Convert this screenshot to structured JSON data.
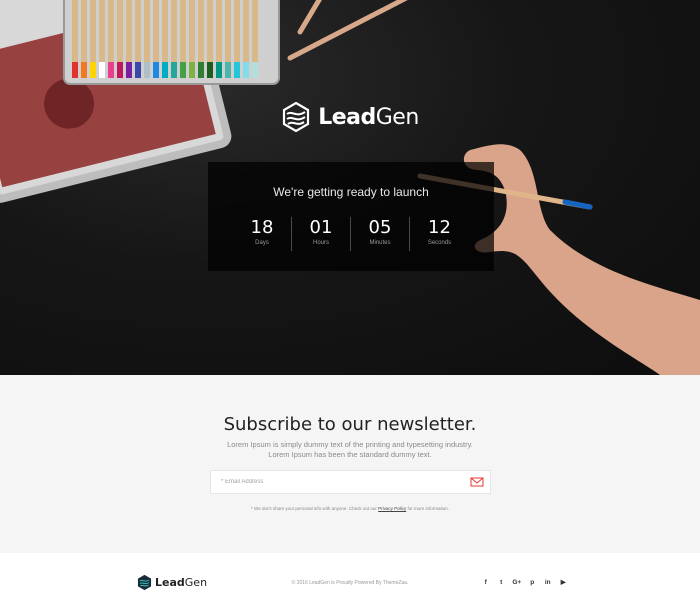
{
  "brand": {
    "name_bold": "Lead",
    "name_rest": "Gen"
  },
  "countdown": {
    "title": "We're getting ready to launch",
    "units": [
      {
        "value": "18",
        "label": "Days"
      },
      {
        "value": "01",
        "label": "Hours"
      },
      {
        "value": "05",
        "label": "Minutes"
      },
      {
        "value": "12",
        "label": "Seconds"
      }
    ]
  },
  "subscribe": {
    "title": "Subscribe to our newsletter.",
    "text_line1": "Lorem Ipsum is simply dummy text of the printing and typesetting industry.",
    "text_line2": "Lorem Ipsum has been the standard dummy text.",
    "email_placeholder": "* Email Address",
    "note_before": "* We don't share your personal info with anyone. Check out our",
    "note_link": "Privacy Policy",
    "note_after": "for more information."
  },
  "footer": {
    "copyright": "© 2016 LeadGen is Proudly Powered By ThemeZaa.",
    "socials": [
      {
        "icon": "facebook-icon",
        "glyph": "f"
      },
      {
        "icon": "twitter-icon",
        "glyph": "t"
      },
      {
        "icon": "google-plus-icon",
        "glyph": "G+"
      },
      {
        "icon": "pinterest-icon",
        "glyph": "p"
      },
      {
        "icon": "linkedin-icon",
        "glyph": "in"
      },
      {
        "icon": "youtube-icon",
        "glyph": "▶"
      }
    ]
  },
  "colors": {
    "accent": "#e53935",
    "hero_bg": "#161616",
    "subscribe_bg": "#f5f5f5"
  }
}
